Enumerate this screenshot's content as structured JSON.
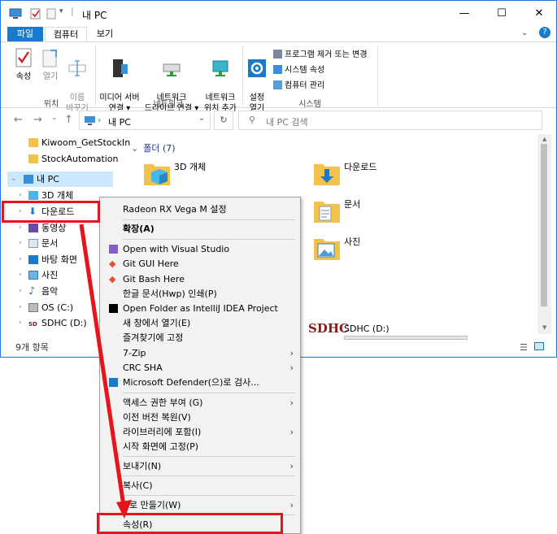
{
  "window": {
    "title": "내 PC",
    "minimize": "—",
    "maximize": "☐",
    "close": "✕",
    "help": "?"
  },
  "ribbon": {
    "tabs": [
      "파일",
      "컴퓨터",
      "보기"
    ],
    "location_group": {
      "label": "위치",
      "buttons": [
        "속성",
        "열기",
        "이름\n바꾸기"
      ]
    },
    "network_group": {
      "label": "네트워크",
      "buttons": [
        "미디어 서버\n연결 ▾",
        "네트워크\n드라이브 연결 ▾",
        "네트워크\n위치 추가"
      ]
    },
    "system_group": {
      "label": "시스템",
      "settings_button": "설정\n열기",
      "small_buttons": [
        "프로그램 제거 또는 변경",
        "시스템 속성",
        "컴퓨터 관리"
      ]
    }
  },
  "address": {
    "path": "내 PC",
    "search_placeholder": "내 PC 검색"
  },
  "nav_pane": {
    "items": [
      {
        "label": "Kiwoom_GetStockIn",
        "icon": "folder-icon"
      },
      {
        "label": "StockAutomation",
        "icon": "folder-icon"
      },
      {
        "label": "내 PC",
        "icon": "pc-icon"
      },
      {
        "label": "3D 개체",
        "icon": "3d-icon"
      },
      {
        "label": "다운로드",
        "icon": "download-icon"
      },
      {
        "label": "동영상",
        "icon": "video-icon"
      },
      {
        "label": "문서",
        "icon": "document-icon"
      },
      {
        "label": "바탕 화면",
        "icon": "desktop-icon"
      },
      {
        "label": "사진",
        "icon": "picture-icon"
      },
      {
        "label": "음악",
        "icon": "music-icon"
      },
      {
        "label": "OS (C:)",
        "icon": "drive-icon"
      },
      {
        "label": "SDHC (D:)",
        "icon": "sdhc-icon"
      }
    ],
    "status": "9개 항목"
  },
  "content": {
    "group_header": "폴더 (7)",
    "folders": [
      "3D 개체",
      "다운로드",
      "문서",
      "사진"
    ],
    "drive_label": "SDHC (D:)",
    "sdhc_logo": "SDHC"
  },
  "context_menu": {
    "items": [
      {
        "label": "Radeon RX Vega M 설정",
        "bold": false
      },
      {
        "label": "확장(A)",
        "bold": true
      },
      {
        "label": "Open with Visual Studio"
      },
      {
        "label": "Git GUI Here"
      },
      {
        "label": "Git Bash Here"
      },
      {
        "label": "한글 문서(Hwp) 인쇄(P)"
      },
      {
        "label": "Open Folder as IntelliJ IDEA Project"
      },
      {
        "label": "새 창에서 열기(E)"
      },
      {
        "label": "즐겨찾기에 고정"
      },
      {
        "label": "7-Zip",
        "submenu": true
      },
      {
        "label": "CRC SHA",
        "submenu": true
      },
      {
        "label": "Microsoft Defender(으)로 검사..."
      },
      {
        "label": "액세스 권한 부여 (G)",
        "submenu": true
      },
      {
        "label": "이전 버전 복원(V)"
      },
      {
        "label": "라이브러리에 포함(I)",
        "submenu": true
      },
      {
        "label": "시작 화면에 고정(P)"
      },
      {
        "label": "보내기(N)",
        "submenu": true
      },
      {
        "label": "복사(C)"
      },
      {
        "label": "로 만들기(W)",
        "submenu": true
      },
      {
        "label": "속성(R)"
      }
    ],
    "submenu_arrow": "›"
  },
  "annotation": {
    "color": "#e8141c"
  }
}
